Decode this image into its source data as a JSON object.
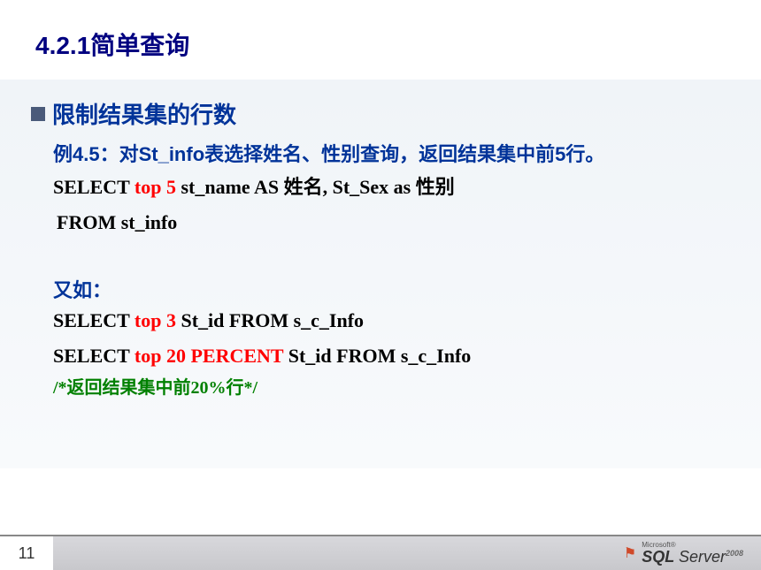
{
  "slide": {
    "title": "4.2.1简单查询",
    "pageNumber": "11"
  },
  "content": {
    "sectionTitle": "限制结果集的行数",
    "exampleDesc": "例4.5：对St_info表选择姓名、性别查询，返回结果集中前5行。",
    "sql1": {
      "select": "SELECT   ",
      "top": "top 5",
      "rest": "   st_name AS 姓名, St_Sex  as 性别",
      "from": " FROM st_info"
    },
    "exampleLabel2": "又如：",
    "sql2": {
      "select": "SELECT ",
      "top": "top 3",
      "rest": " St_id  FROM s_c_Info"
    },
    "sql3": {
      "select": "SELECT ",
      "top": "top 20 PERCENT",
      "rest": " St_id  FROM  s_c_Info"
    },
    "comment": "/*返回结果集中前20%行*/"
  },
  "footer": {
    "logoMs": "Microsoft®",
    "logoSql": "SQL ",
    "logoServer": "Server",
    "logoYear": "2008"
  }
}
